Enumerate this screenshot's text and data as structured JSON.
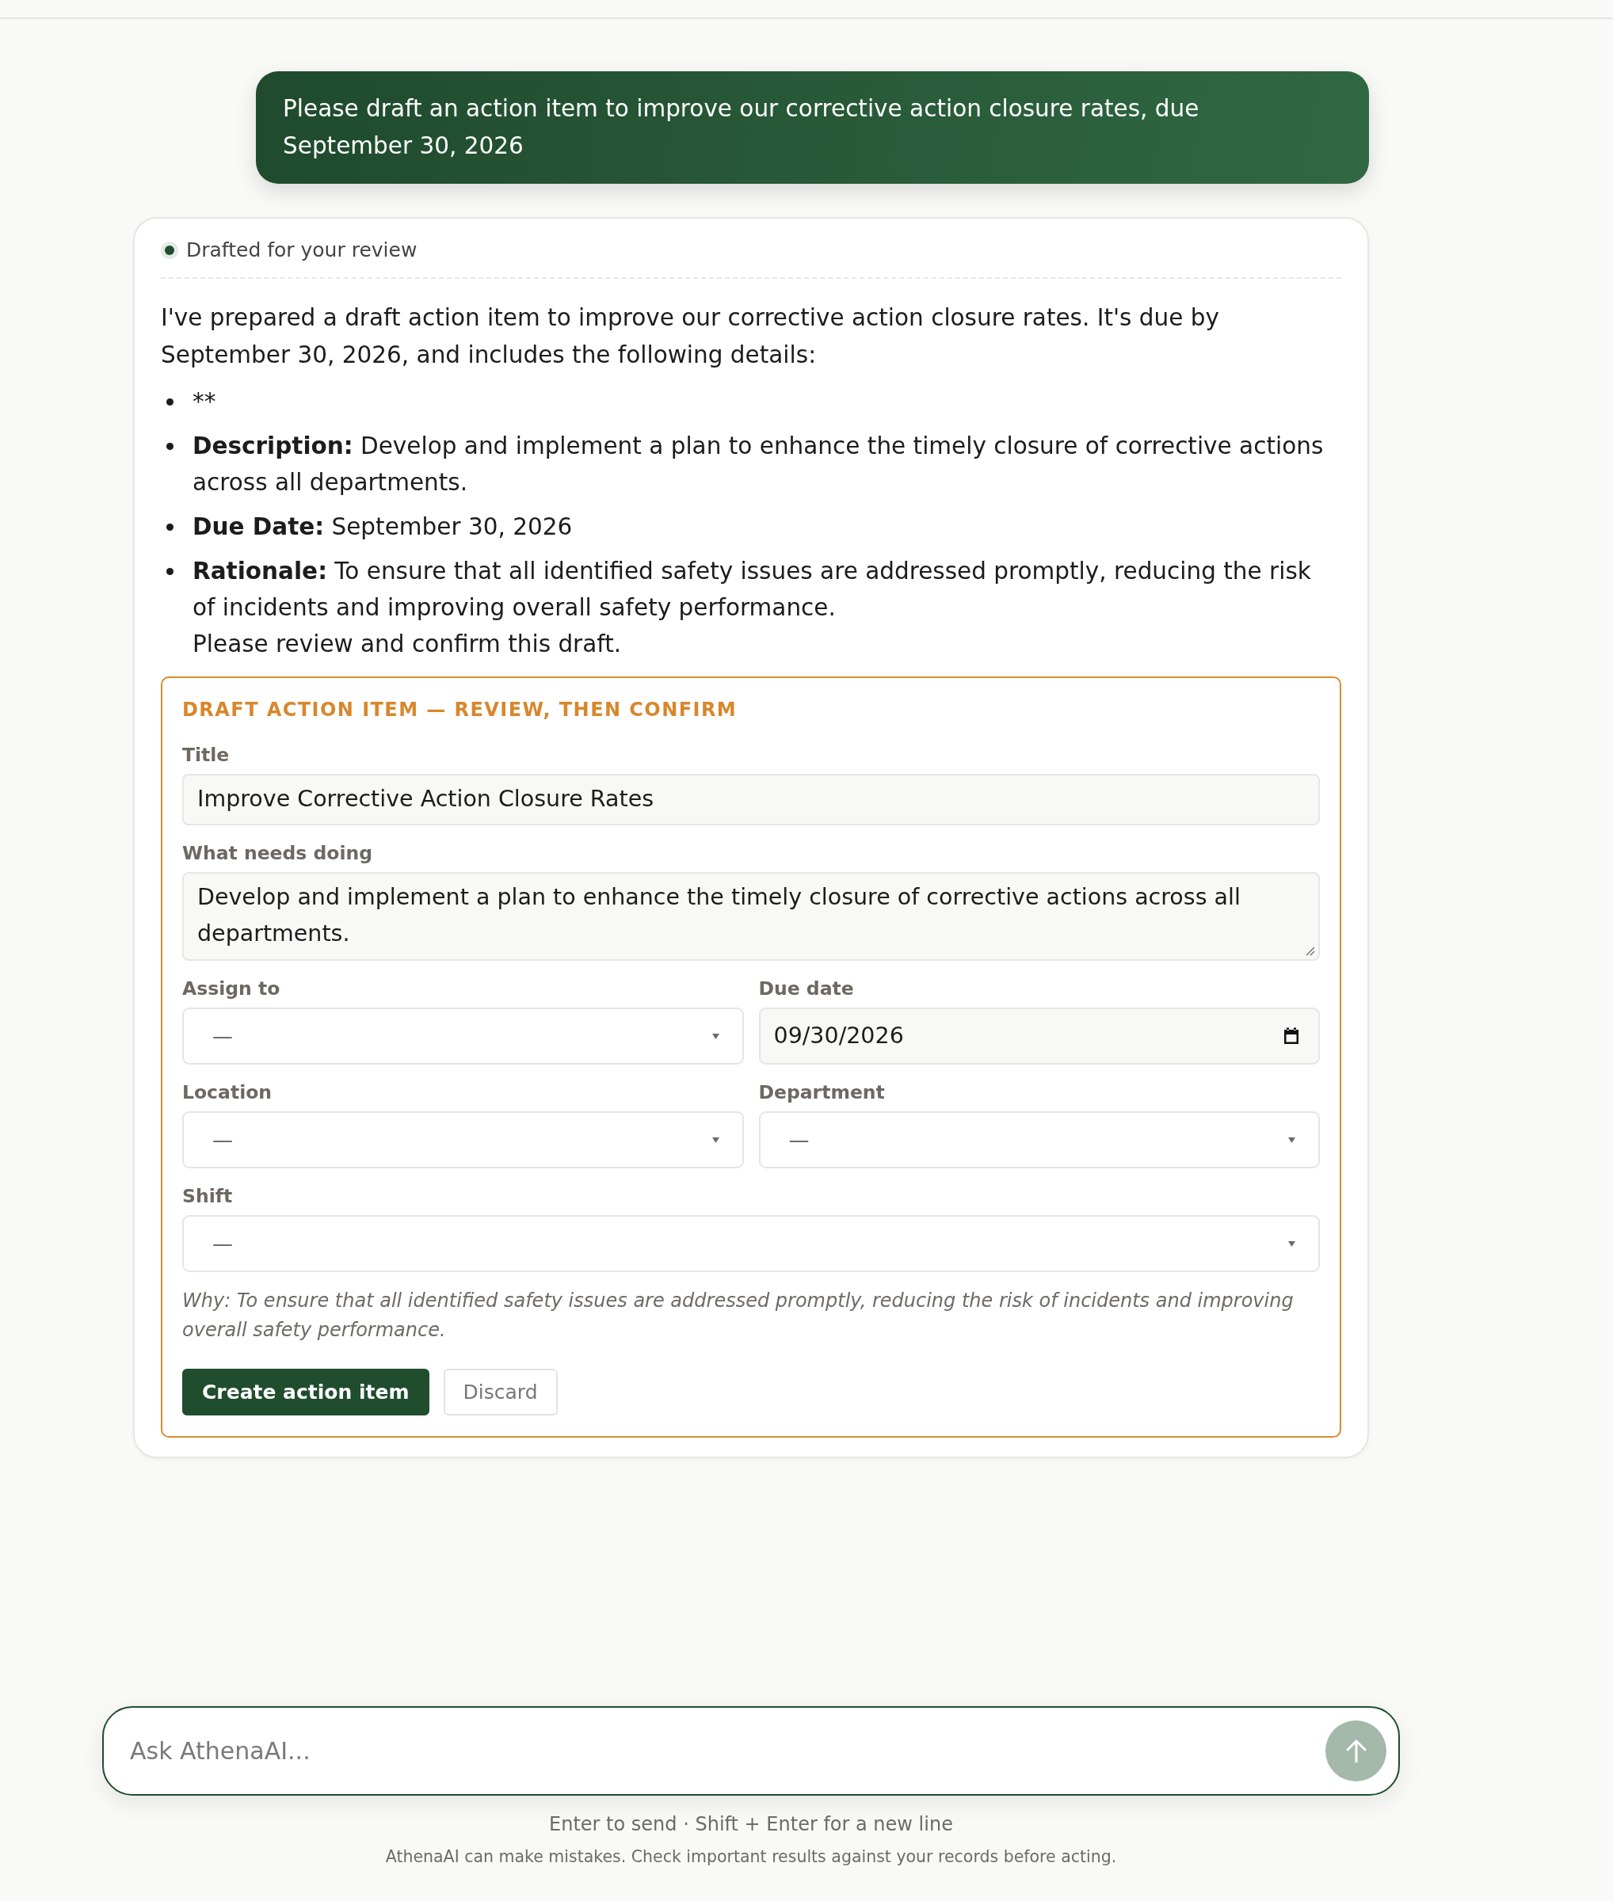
{
  "user_message": {
    "text": "Please draft an action item to improve our corrective action closure rates, due September 30, 2026"
  },
  "assistant_message": {
    "status": "Drafted for your review",
    "intro": "I've prepared a draft action item to improve our corrective action closure rates. It's due by September 30, 2026, and includes the following details:",
    "bullets": [
      {
        "text": "**"
      },
      {
        "label": "Description:",
        "text": "Develop and implement a plan to enhance the timely closure of corrective actions across all departments."
      },
      {
        "label": "Due Date:",
        "text": "September 30, 2026"
      },
      {
        "label": "Rationale:",
        "text": "To ensure that all identified safety issues are addressed promptly, reducing the risk of incidents and improving overall safety performance."
      }
    ],
    "closing": "Please review and confirm this draft.",
    "draft_form": {
      "heading": "DRAFT ACTION ITEM — REVIEW, THEN CONFIRM",
      "rows": [
        [
          {
            "label": "Title",
            "kind": "text",
            "value": "Improve Corrective Action Closure Rates"
          }
        ],
        [
          {
            "label": "What needs doing",
            "kind": "textarea",
            "value": "Develop and implement a plan to enhance the timely closure of corrective actions across all departments."
          }
        ],
        [
          {
            "label": "Assign to",
            "kind": "select",
            "value": "—"
          },
          {
            "label": "Due date",
            "kind": "date",
            "value": "09/30/2026"
          }
        ],
        [
          {
            "label": "Location",
            "kind": "select",
            "value": "—"
          },
          {
            "label": "Department",
            "kind": "select",
            "value": "—"
          }
        ],
        [
          {
            "label": "Shift",
            "kind": "select",
            "value": "—"
          }
        ]
      ],
      "why": "Why: To ensure that all identified safety issues are addressed promptly, reducing the risk of incidents and improving overall safety performance.",
      "buttons": [
        {
          "label": "Create action item",
          "kind": "primary"
        },
        {
          "label": "Discard",
          "kind": "secondary"
        }
      ]
    }
  },
  "composer": {
    "placeholder": "Ask AthenaAI...",
    "send_button": {
      "disabled": true
    },
    "hint": "Enter to send · Shift + Enter for a new line",
    "disclaimer": "AthenaAI can make mistakes. Check important results against your records before acting."
  }
}
